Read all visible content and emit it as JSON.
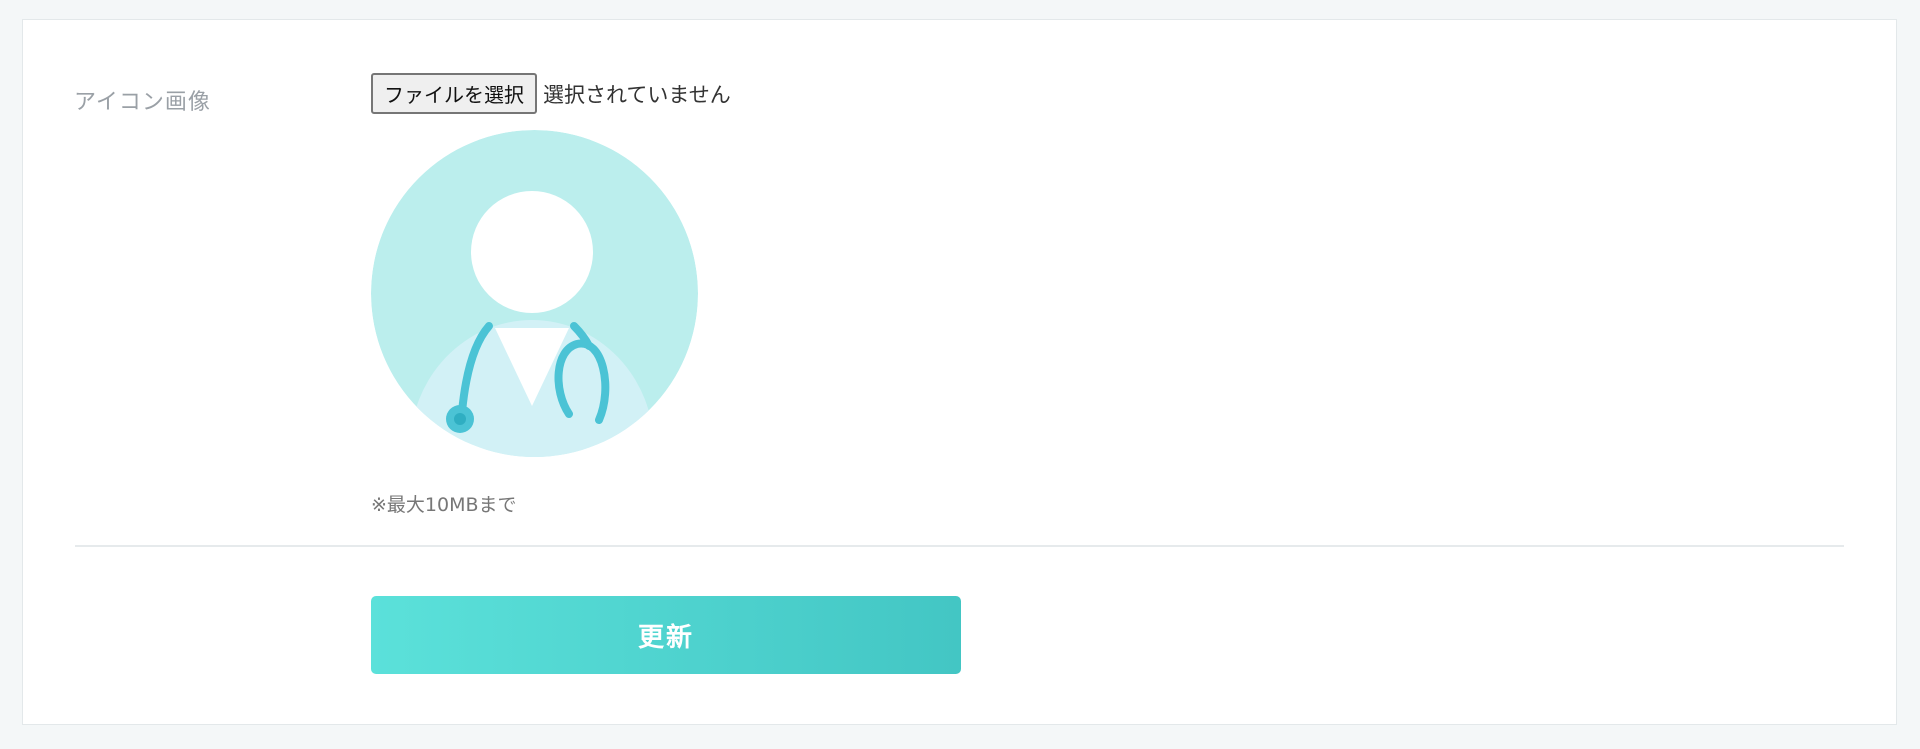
{
  "form": {
    "icon_field": {
      "label": "アイコン画像",
      "file_button_label": "ファイルを選択",
      "file_status": "選択されていません",
      "preview_icon": "doctor-avatar-icon",
      "size_note": "※最大10MBまで"
    },
    "submit": {
      "label": "更新"
    }
  },
  "colors": {
    "page_background": "#f4f7f8",
    "avatar_circle": "#bbeeed",
    "avatar_coat": "#d2f1f6",
    "stethoscope": "#4bc3d5",
    "button_gradient_start": "#5be1da",
    "button_gradient_end": "#43c6c4"
  }
}
